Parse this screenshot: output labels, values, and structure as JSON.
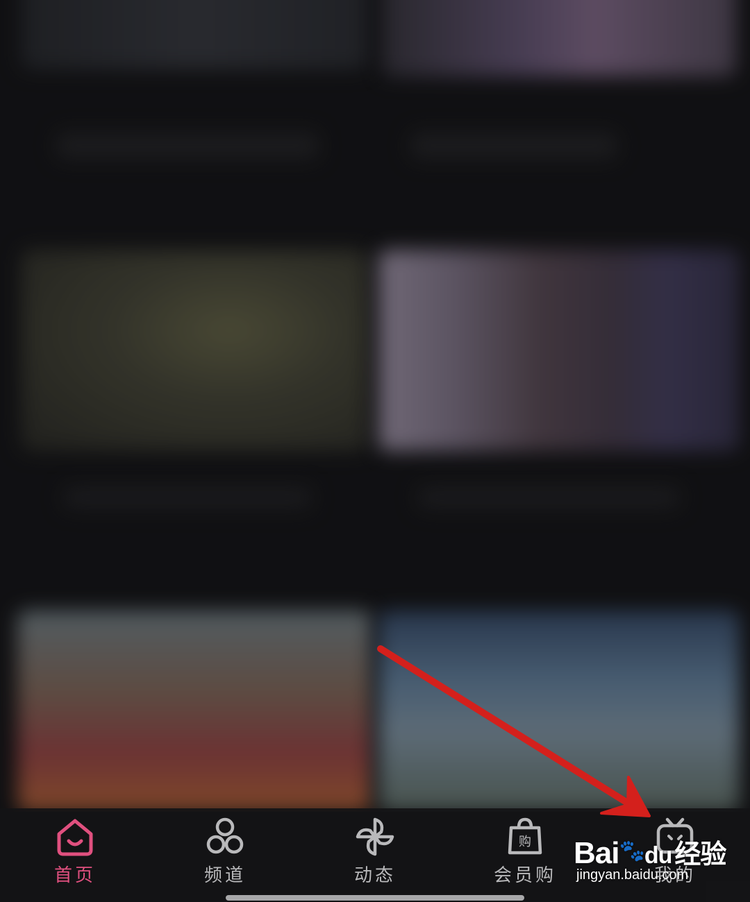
{
  "tabbar": {
    "tabs": [
      {
        "label": "首页",
        "icon": "home-icon",
        "active": true
      },
      {
        "label": "频道",
        "icon": "channel-icon",
        "active": false
      },
      {
        "label": "动态",
        "icon": "pinwheel-icon",
        "active": false
      },
      {
        "label": "会员购",
        "icon": "shopping-bag-icon",
        "active": false
      },
      {
        "label": "我的",
        "icon": "tv-icon",
        "active": false
      }
    ],
    "active_color": "#e0507f",
    "inactive_color": "#b9b9bb"
  },
  "watermark": {
    "brand": "Bai",
    "brand_suffix": "du",
    "product": "经验",
    "url": "jingyan.baidu.com"
  },
  "annotation": {
    "arrow_color": "#d4201c"
  }
}
